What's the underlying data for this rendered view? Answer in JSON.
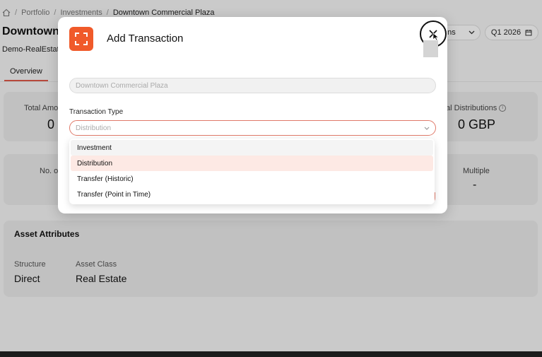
{
  "breadcrumb": {
    "home_icon": "home-icon",
    "items": [
      "Portfolio",
      "Investments",
      "Downtown Commercial Plaza"
    ],
    "separator": "/"
  },
  "page": {
    "title": "Downtown C",
    "subtitle": "Demo-RealEstate",
    "tab": "Overview"
  },
  "header_controls": {
    "actions_label": "ons",
    "period_label": "Q1 2026",
    "calendar_icon": "calendar-icon"
  },
  "stats_row1": {
    "total_amount_label": "Total Amo",
    "total_amount_value": "0",
    "total_distributions_label": "tal Distributions",
    "total_distributions_value": "0 GBP"
  },
  "stats_row2": {
    "count_label": "No. of",
    "multiple_label": "Multiple",
    "multiple_value": "-"
  },
  "asset_attributes": {
    "title": "Asset Attributes",
    "structure_label": "Structure",
    "structure_value": "Direct",
    "asset_class_label": "Asset Class",
    "asset_class_value": "Real Estate"
  },
  "modal": {
    "title": "Add Transaction",
    "close_icon": "close-icon",
    "asset_placeholder": "Downtown Commercial Plaza",
    "transaction_type_label": "Transaction Type",
    "transaction_type_value": "Distribution",
    "dropdown_options": [
      "Investment",
      "Distribution",
      "Transfer (Historic)",
      "Transfer (Point in Time)"
    ]
  },
  "colors": {
    "accent": "#f05a2a",
    "selected_bg": "#fde9e4",
    "focus_border": "#e07a6a"
  }
}
